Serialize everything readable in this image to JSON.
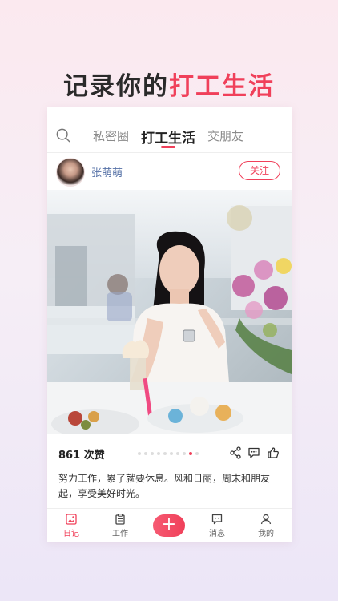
{
  "headline": {
    "prefix": "记录你的",
    "accent": "打工生活"
  },
  "top_tabs": [
    {
      "label": "私密圈"
    },
    {
      "label": "打工生活"
    },
    {
      "label": "交朋友"
    }
  ],
  "post": {
    "username": "张萌萌",
    "follow_label": "关注",
    "likes": "861 次赞",
    "caption": "努力工作，累了就要休息。风和日丽，周末和朋友一起，享受美好时光。",
    "carousel": {
      "count": 10,
      "active_index": 8
    }
  },
  "bottom_nav": [
    {
      "label": "日记"
    },
    {
      "label": "工作"
    },
    {
      "label": "+"
    },
    {
      "label": "消息"
    },
    {
      "label": "我的"
    }
  ],
  "colors": {
    "accent": "#f0405a",
    "username": "#5470a6"
  }
}
